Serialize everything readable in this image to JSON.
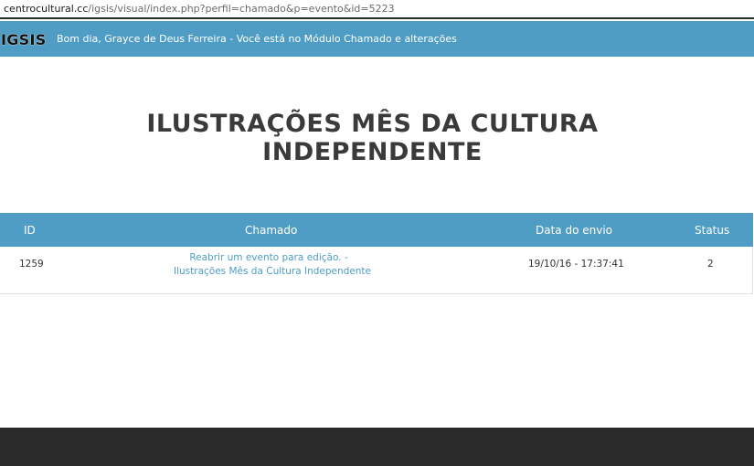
{
  "browser": {
    "url_host": "centrocultural.cc",
    "url_path": "/igsis/visual/index.php?perfil=chamado&p=evento&id=5223"
  },
  "header": {
    "logo": "IGSIS",
    "greeting": "Bom dia, Grayce de Deus Ferreira - Você está no Módulo Chamado e alterações"
  },
  "page": {
    "title_line1": "ILUSTRAÇÕES MÊS DA CULTURA",
    "title_line2": "INDEPENDENTE"
  },
  "table": {
    "columns": [
      "ID",
      "Chamado",
      "Data do envio",
      "Status"
    ],
    "rows": [
      {
        "id": "1259",
        "chamado_line1": "Reabrir um evento para edição. -",
        "chamado_line2": "Ilustrações Mês da Cultura Independente",
        "data": "19/10/16 - 17:37:41",
        "status": "2"
      }
    ]
  },
  "colors": {
    "accent": "#4f9dc4",
    "footer": "#2a2a2a",
    "title": "#3a3a3a"
  }
}
